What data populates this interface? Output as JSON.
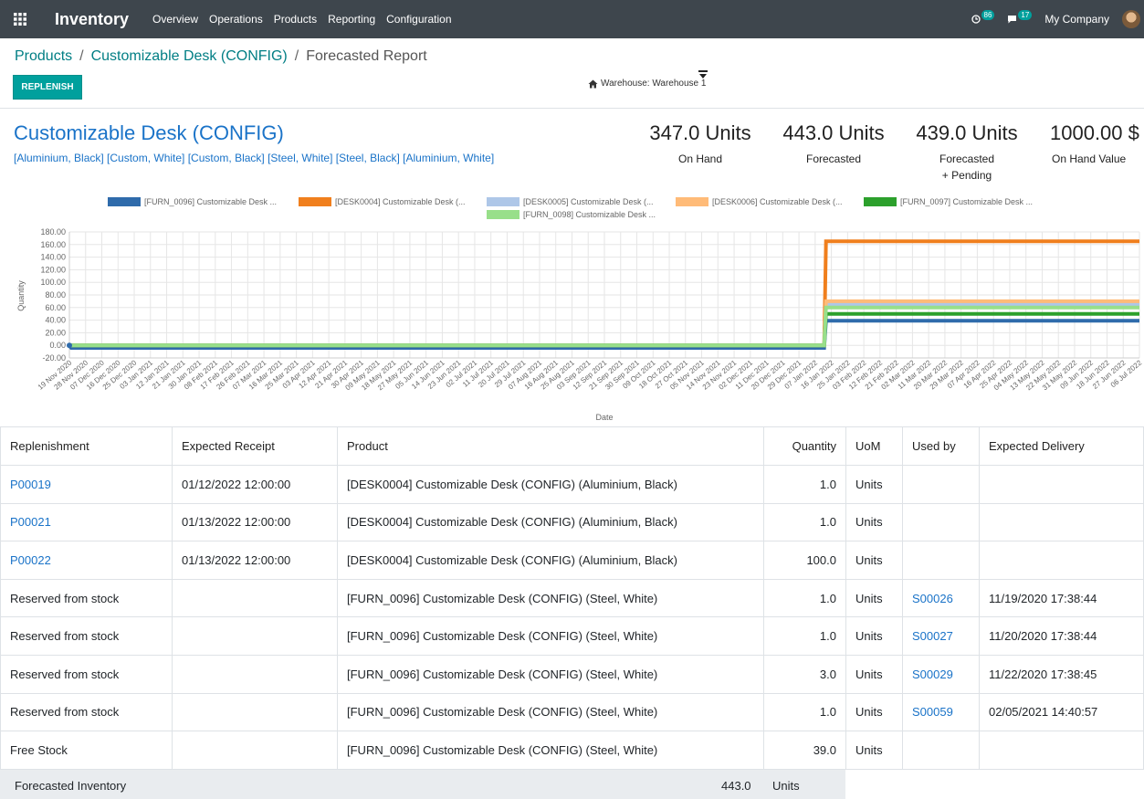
{
  "navbar": {
    "app_name": "Inventory",
    "menu": [
      "Overview",
      "Operations",
      "Products",
      "Reporting",
      "Configuration"
    ],
    "activity_count": "86",
    "message_count": "17",
    "company": "My Company"
  },
  "breadcrumb": {
    "products": "Products",
    "product": "Customizable Desk (CONFIG)",
    "current": "Forecasted Report",
    "separator": "/"
  },
  "actions": {
    "replenish_label": "REPLENISH"
  },
  "warehouse": {
    "label": "Warehouse: Warehouse 1"
  },
  "product": {
    "title": "Customizable Desk (CONFIG)",
    "variants": "[Aluminium, Black] [Custom, White] [Custom, Black] [Steel, White] [Steel, Black] [Aluminium, White]"
  },
  "stats": {
    "on_hand": {
      "value": "347.0 Units",
      "label": "On Hand"
    },
    "forecasted": {
      "value": "443.0 Units",
      "label": "Forecasted"
    },
    "forecasted_pending": {
      "value": "439.0 Units",
      "label1": "Forecasted",
      "label2": "+ Pending"
    },
    "on_hand_value": {
      "value": "1000.00 $",
      "label": "On Hand Value"
    }
  },
  "chart_data": {
    "type": "line",
    "xlabel": "Date",
    "ylabel": "Quantity",
    "ylim": [
      -20,
      180
    ],
    "yticks": [
      -20,
      0,
      20,
      40,
      60,
      80,
      100,
      120,
      140,
      160,
      180
    ],
    "ytick_labels": [
      "-20.00",
      "0.00",
      "20.00",
      "40.00",
      "60.00",
      "80.00",
      "100.00",
      "120.00",
      "140.00",
      "160.00",
      "180.00"
    ],
    "grid": true,
    "legend_placement": "top",
    "x": [
      "19 Nov 2020",
      "28 Nov 2020",
      "07 Dec 2020",
      "16 Dec 2020",
      "25 Dec 2020",
      "03 Jan 2021",
      "12 Jan 2021",
      "21 Jan 2021",
      "30 Jan 2021",
      "08 Feb 2021",
      "17 Feb 2021",
      "26 Feb 2021",
      "07 Mar 2021",
      "16 Mar 2021",
      "25 Mar 2021",
      "03 Apr 2021",
      "12 Apr 2021",
      "21 Apr 2021",
      "30 Apr 2021",
      "09 May 2021",
      "18 May 2021",
      "27 May 2021",
      "05 Jun 2021",
      "14 Jun 2021",
      "23 Jun 2021",
      "02 Jul 2021",
      "11 Jul 2021",
      "20 Jul 2021",
      "29 Jul 2021",
      "07 Aug 2021",
      "16 Aug 2021",
      "25 Aug 2021",
      "03 Sep 2021",
      "12 Sep 2021",
      "21 Sep 2021",
      "30 Sep 2021",
      "09 Oct 2021",
      "18 Oct 2021",
      "27 Oct 2021",
      "05 Nov 2021",
      "14 Nov 2021",
      "23 Nov 2021",
      "02 Dec 2021",
      "11 Dec 2021",
      "20 Dec 2021",
      "29 Dec 2021",
      "07 Jan 2022",
      "16 Jan 2022",
      "25 Jan 2022",
      "03 Feb 2022",
      "12 Feb 2022",
      "21 Feb 2022",
      "02 Mar 2022",
      "11 Mar 2022",
      "20 Mar 2022",
      "29 Mar 2022",
      "07 Apr 2022",
      "16 Apr 2022",
      "25 Apr 2022",
      "04 May 2022",
      "13 May 2022",
      "22 May 2022",
      "31 May 2022",
      "09 Jun 2022",
      "18 Jun 2022",
      "27 Jun 2022",
      "06 Jul 2022"
    ],
    "series": [
      {
        "name": "[FURN_0096] Customizable Desk ...",
        "color": "#2f6bab",
        "points": [
          [
            "19 Nov 2020",
            0
          ],
          [
            "20 Nov 2020",
            -4
          ],
          [
            "12 Jan 2022",
            -4
          ],
          [
            "13 Jan 2022",
            39
          ],
          [
            "06 Jul 2022",
            39
          ]
        ]
      },
      {
        "name": "[DESK0004] Customizable Desk (...",
        "color": "#f07f1d",
        "points": [
          [
            "19 Nov 2020",
            0
          ],
          [
            "12 Jan 2022",
            0
          ],
          [
            "13 Jan 2022",
            165
          ],
          [
            "06 Jul 2022",
            165
          ]
        ]
      },
      {
        "name": "[DESK0005] Customizable Desk (...",
        "color": "#aec7e8",
        "points": [
          [
            "19 Nov 2020",
            0
          ],
          [
            "12 Jan 2022",
            0
          ],
          [
            "13 Jan 2022",
            65
          ],
          [
            "06 Jul 2022",
            65
          ]
        ]
      },
      {
        "name": "[DESK0006] Customizable Desk (...",
        "color": "#ffbb78",
        "points": [
          [
            "19 Nov 2020",
            0
          ],
          [
            "12 Jan 2022",
            0
          ],
          [
            "13 Jan 2022",
            70
          ],
          [
            "06 Jul 2022",
            70
          ]
        ]
      },
      {
        "name": "[FURN_0097] Customizable Desk ...",
        "color": "#2ca02c",
        "points": [
          [
            "19 Nov 2020",
            0
          ],
          [
            "12 Jan 2022",
            0
          ],
          [
            "13 Jan 2022",
            50
          ],
          [
            "06 Jul 2022",
            50
          ]
        ]
      },
      {
        "name": "[FURN_0098] Customizable Desk ...",
        "color": "#98df8a",
        "points": [
          [
            "19 Nov 2020",
            0
          ],
          [
            "12 Jan 2022",
            0
          ],
          [
            "13 Jan 2022",
            60
          ],
          [
            "06 Jul 2022",
            60
          ]
        ]
      }
    ]
  },
  "table": {
    "headers": [
      "Replenishment",
      "Expected Receipt",
      "Product",
      "Quantity",
      "UoM",
      "Used by",
      "Expected Delivery"
    ],
    "rows": [
      {
        "replenishment": "P00019",
        "receipt": "01/12/2022 12:00:00",
        "product": "[DESK0004] Customizable Desk (CONFIG) (Aluminium, Black)",
        "quantity": "1.0",
        "uom": "Units",
        "used_by": "",
        "delivery": ""
      },
      {
        "replenishment": "P00021",
        "receipt": "01/13/2022 12:00:00",
        "product": "[DESK0004] Customizable Desk (CONFIG) (Aluminium, Black)",
        "quantity": "1.0",
        "uom": "Units",
        "used_by": "",
        "delivery": ""
      },
      {
        "replenishment": "P00022",
        "receipt": "01/13/2022 12:00:00",
        "product": "[DESK0004] Customizable Desk (CONFIG) (Aluminium, Black)",
        "quantity": "100.0",
        "uom": "Units",
        "used_by": "",
        "delivery": ""
      },
      {
        "replenishment": "Reserved from stock",
        "receipt": "",
        "product": "[FURN_0096] Customizable Desk (CONFIG) (Steel, White)",
        "quantity": "1.0",
        "uom": "Units",
        "used_by": "S00026",
        "delivery": "11/19/2020 17:38:44"
      },
      {
        "replenishment": "Reserved from stock",
        "receipt": "",
        "product": "[FURN_0096] Customizable Desk (CONFIG) (Steel, White)",
        "quantity": "1.0",
        "uom": "Units",
        "used_by": "S00027",
        "delivery": "11/20/2020 17:38:44"
      },
      {
        "replenishment": "Reserved from stock",
        "receipt": "",
        "product": "[FURN_0096] Customizable Desk (CONFIG) (Steel, White)",
        "quantity": "3.0",
        "uom": "Units",
        "used_by": "S00029",
        "delivery": "11/22/2020 17:38:45"
      },
      {
        "replenishment": "Reserved from stock",
        "receipt": "",
        "product": "[FURN_0096] Customizable Desk (CONFIG) (Steel, White)",
        "quantity": "1.0",
        "uom": "Units",
        "used_by": "S00059",
        "delivery": "02/05/2021 14:40:57"
      },
      {
        "replenishment": "Free Stock",
        "receipt": "",
        "product": "[FURN_0096] Customizable Desk (CONFIG) (Steel, White)",
        "quantity": "39.0",
        "uom": "Units",
        "used_by": "",
        "delivery": ""
      }
    ],
    "footer": {
      "label": "Forecasted Inventory",
      "quantity": "443.0",
      "uom": "Units"
    }
  }
}
